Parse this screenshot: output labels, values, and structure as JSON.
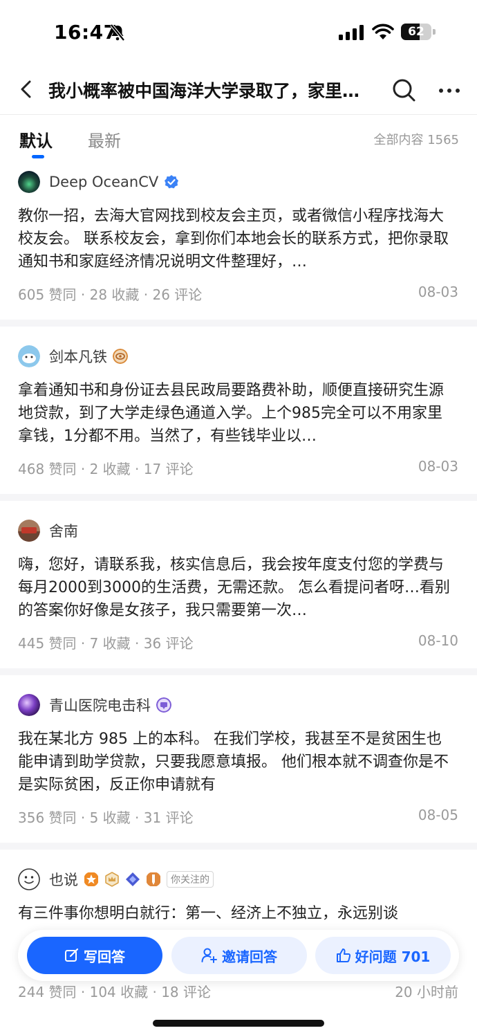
{
  "status_bar": {
    "time": "16:47",
    "battery": "62",
    "battery_level": 0.62
  },
  "nav": {
    "title": "我小概率被中国海洋大学录取了，家里拿不出学费怎么办？"
  },
  "tabs": [
    {
      "label": "默认"
    },
    {
      "label": "最新"
    }
  ],
  "total_label": "全部内容 1565",
  "answers": [
    {
      "author": "Deep OceanCV",
      "excerpt": "教你一招，去海大官网找到校友会主页，或者微信小程序找海大校友会。 联系校友会，拿到你们本地会长的联系方式，把你录取通知书和家庭经济情况说明文件整理好，…",
      "meta": "605 赞同 · 28 收藏 · 26 评论",
      "date": "08-03",
      "colors": {
        "avatar": "#1d4a3a",
        "badge": "#3b82f6"
      }
    },
    {
      "author": "剑本凡铁",
      "excerpt": "拿着通知书和身份证去县民政局要路费补助，顺便直接研究生源地贷款，到了大学走绿色通道入学。上个985完全可以不用家里拿钱，1分都不用。当然了，有些钱毕业以…",
      "meta": "468 赞同 · 2 收藏 · 17 评论",
      "date": "08-03",
      "colors": {
        "avatar": "#8cc8ec",
        "badge": "#d98a3a"
      }
    },
    {
      "author": "舍南",
      "excerpt": "嗨，您好，请联系我，核实信息后，我会按年度支付您的学费与每月2000到3000的生活费，无需还款。 怎么看提问者呀…看别的答案你好像是女孩子，我只需要第一次…",
      "meta": "445 赞同 · 7 收藏 · 36 评论",
      "date": "08-10",
      "colors": {
        "avatar": "#8a5a44"
      }
    },
    {
      "author": "青山医院电击科",
      "excerpt": "我在某北方 985 上的本科。 在我们学校，我甚至不是贫困生也能申请到助学贷款，只要我愿意填报。 他们根本就不调查你是不是实际贫困，反正你申请就有",
      "meta": "356 赞同 · 5 收藏 · 31 评论",
      "date": "08-05",
      "colors": {
        "avatar": "#7b3fc4",
        "badge": "#7c5cd6"
      }
    },
    {
      "author": "也说",
      "follow_tag": "你关注的",
      "excerpt": "有三件事你想明白就行：第一、经济上不独立，永远别谈",
      "meta": "244 赞同 · 104 收藏 · 18 评论",
      "date": "20 小时前",
      "colors": {
        "avatar": "#ffffff",
        "badges": [
          "#f08a24",
          "#d9a24a",
          "#4a5bd4",
          "#e0873a"
        ]
      }
    }
  ],
  "actions": {
    "write": "写回答",
    "invite": "邀请回答",
    "good_question": "好问题 701"
  },
  "icons": {
    "back": "back-arrow-icon",
    "search": "search-icon",
    "more": "more-icon",
    "bell_off": "bell-off-icon",
    "signal": "signal-icon",
    "wifi": "wifi-icon"
  },
  "colors": {
    "accent": "#1a66ff",
    "accent_light": "#ebf1ff",
    "meta_text": "#9a9a9a"
  }
}
